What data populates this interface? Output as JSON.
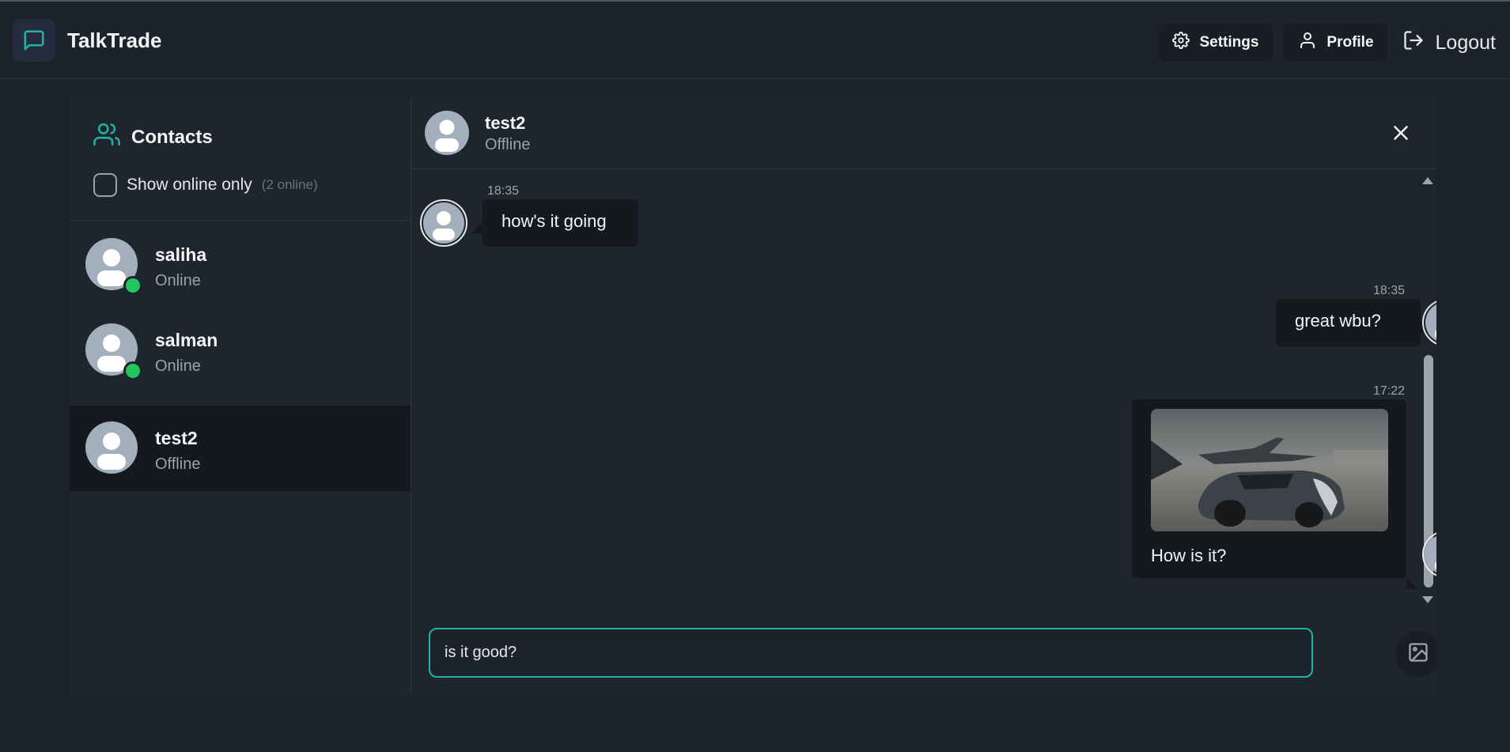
{
  "app": {
    "name": "TalkTrade",
    "logo_icon": "message-square-icon",
    "accent": "#1fb2a6"
  },
  "nav": {
    "settings_label": "Settings",
    "profile_label": "Profile",
    "logout_label": "Logout"
  },
  "contacts": {
    "title": "Contacts",
    "filter_label": "Show online only",
    "filter_checked": false,
    "online_count": "(2 online)",
    "items": [
      {
        "name": "saliha",
        "status": "Online",
        "online": true
      },
      {
        "name": "salman",
        "status": "Online",
        "online": true
      },
      {
        "name": "test2",
        "status": "Offline",
        "online": false,
        "selected": true
      }
    ]
  },
  "chat": {
    "name": "test2",
    "status": "Offline",
    "messages": [
      {
        "time": "18:35",
        "text": "how's it going",
        "side": "left"
      },
      {
        "time": "18:35",
        "text": "great wbu?",
        "side": "right"
      },
      {
        "time": "17:22",
        "text": "How is it?",
        "side": "right",
        "has_image": true
      }
    ]
  },
  "composer": {
    "value": "is it good?",
    "image_button_icon": "image-icon",
    "send_button_icon": "send-icon"
  },
  "colors": {
    "online": "#22c55e",
    "background": "#1d232a",
    "bubble": "#15191e"
  }
}
